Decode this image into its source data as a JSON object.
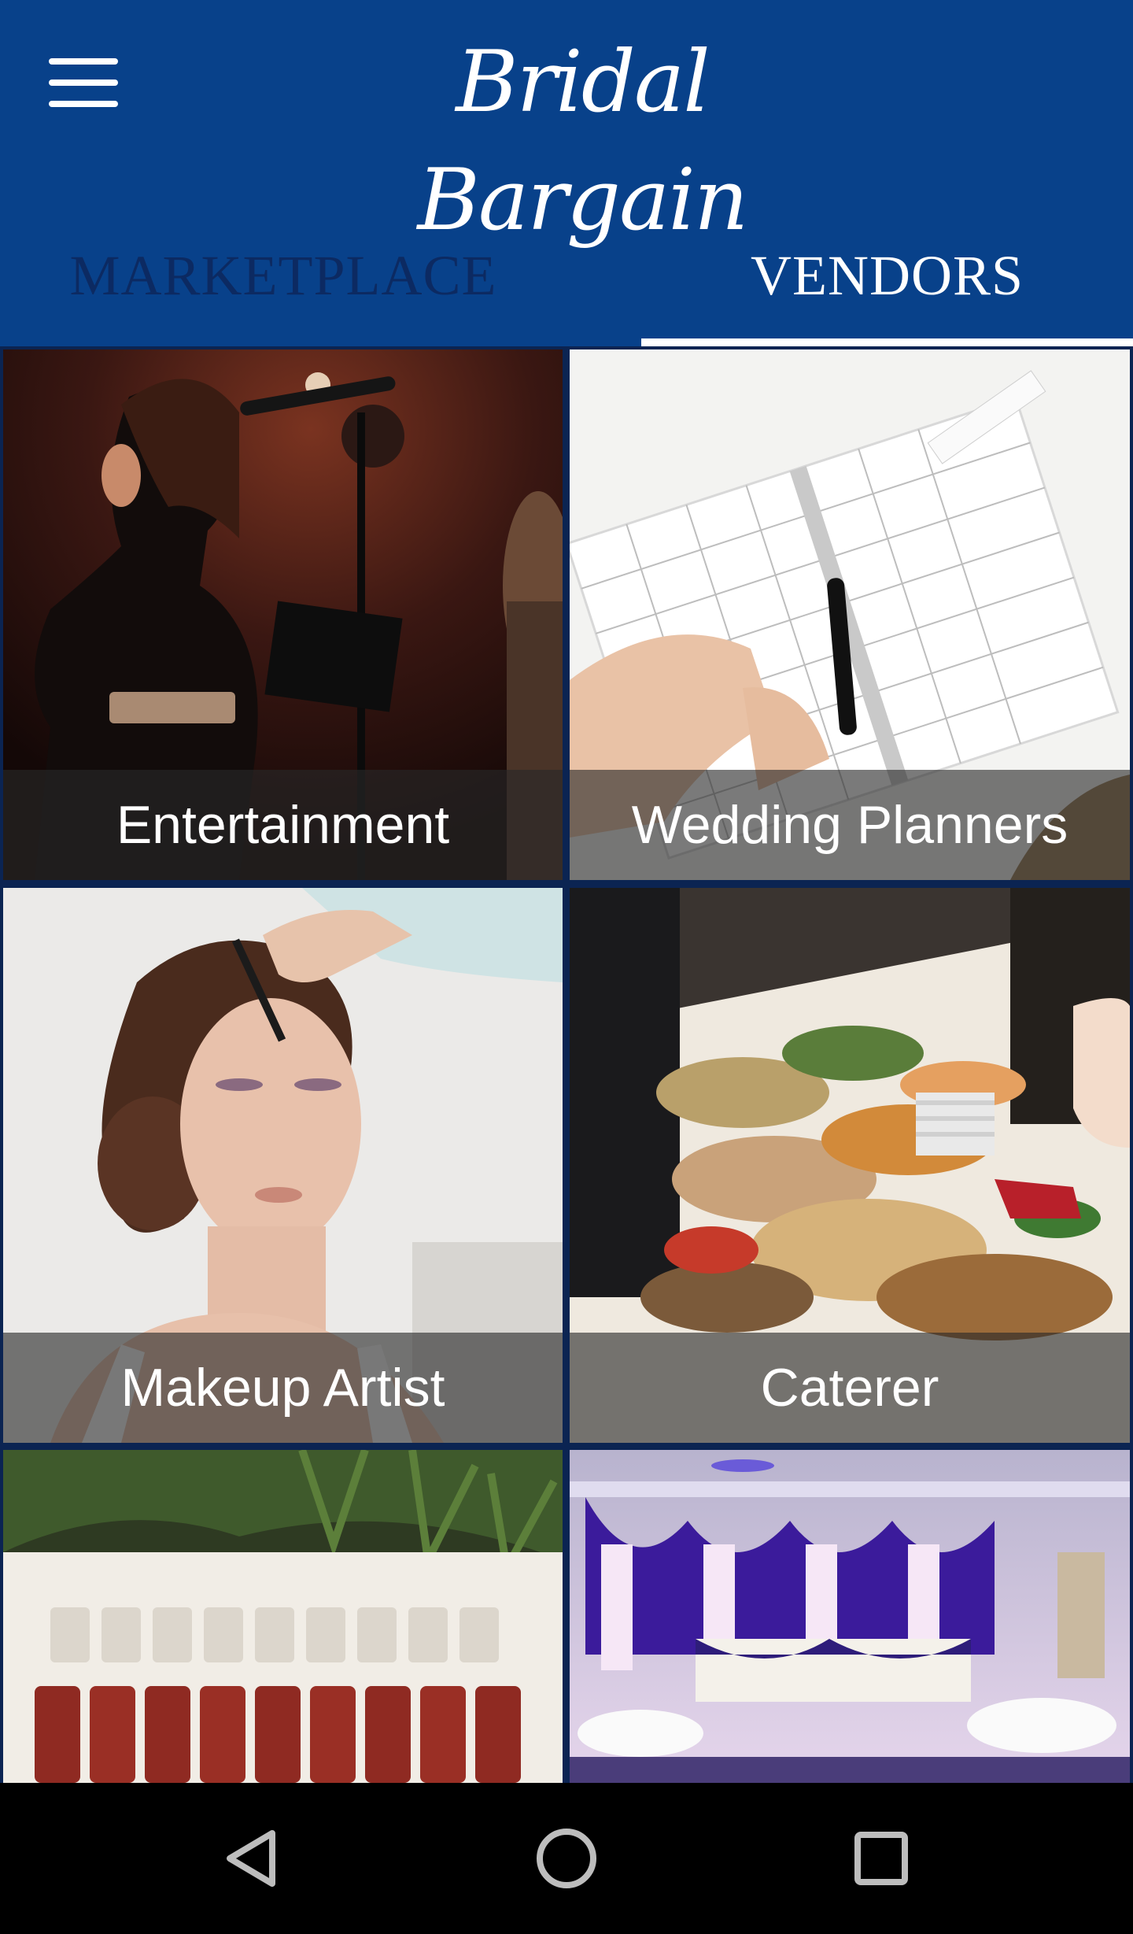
{
  "header": {
    "title": "Bridal Bargain",
    "menu_icon": "hamburger-menu-icon",
    "background": "#08418a"
  },
  "tabs": [
    {
      "label": "MARKETPLACE",
      "selected": false
    },
    {
      "label": "VENDORS",
      "selected": true
    }
  ],
  "vendors": [
    {
      "label": "Entertainment"
    },
    {
      "label": "Wedding Planners"
    },
    {
      "label": "Makeup Artist"
    },
    {
      "label": "Caterer"
    },
    {
      "label": ""
    },
    {
      "label": ""
    }
  ],
  "navigation": {
    "back_icon": "back-triangle-icon",
    "home_icon": "home-circle-icon",
    "recents_icon": "recents-square-icon"
  }
}
